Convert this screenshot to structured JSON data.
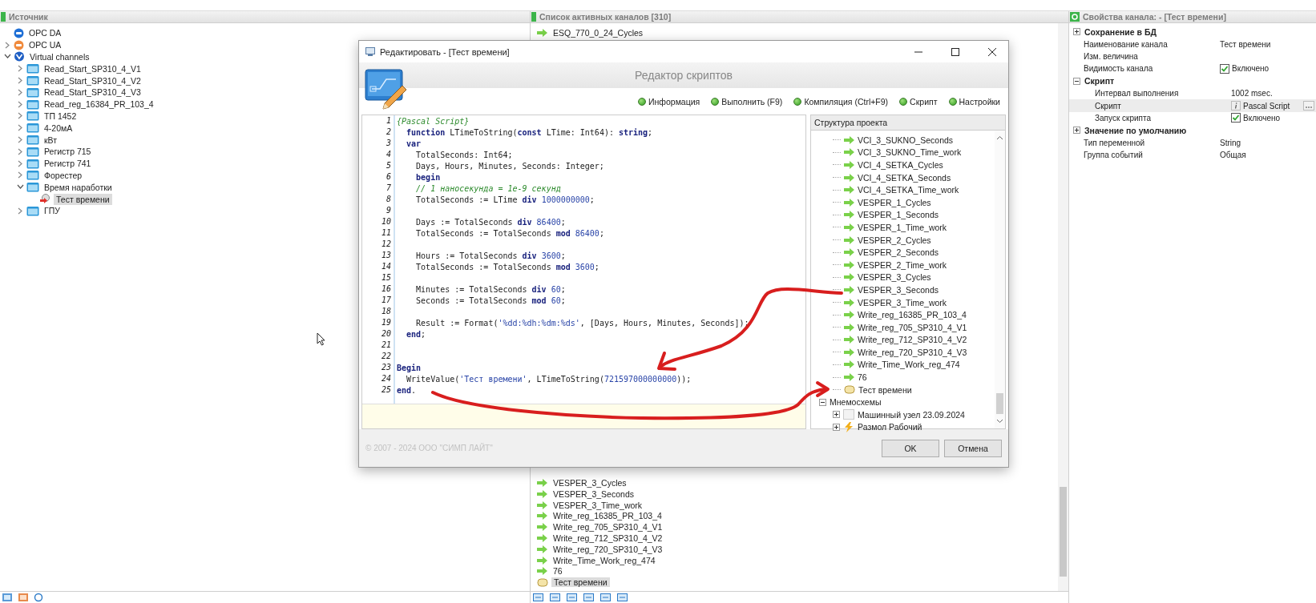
{
  "source_panel": {
    "title": "Источник",
    "tree": [
      {
        "label": "OPC DA",
        "kind": "opc-da",
        "selected": false
      },
      {
        "label": "OPC UA",
        "kind": "opc-ua",
        "expanded": false,
        "selected": false
      },
      {
        "label": "Virtual channels",
        "kind": "virtual",
        "expanded": true,
        "selected": false,
        "children": [
          {
            "label": "Read_Start_SP310_4_V1",
            "kind": "folder",
            "expanded": false,
            "selected": false
          },
          {
            "label": "Read_Start_SP310_4_V2",
            "kind": "folder",
            "expanded": false,
            "selected": false
          },
          {
            "label": "Read_Start_SP310_4_V3",
            "kind": "folder",
            "expanded": false,
            "selected": false
          },
          {
            "label": "Read_reg_16384_PR_103_4",
            "kind": "folder",
            "expanded": false,
            "selected": false
          },
          {
            "label": "ТП 1452",
            "kind": "folder",
            "expanded": false,
            "selected": false
          },
          {
            "label": "4-20мА",
            "kind": "folder",
            "expanded": false,
            "selected": false
          },
          {
            "label": "кВт",
            "kind": "folder",
            "expanded": false,
            "selected": false
          },
          {
            "label": "Регистр 715",
            "kind": "folder",
            "expanded": false,
            "selected": false
          },
          {
            "label": "Регистр 741",
            "kind": "folder",
            "expanded": false,
            "selected": false
          },
          {
            "label": "Форестер",
            "kind": "folder",
            "expanded": false,
            "selected": false
          },
          {
            "label": "Время наработки",
            "kind": "folder",
            "expanded": true,
            "selected": false,
            "children": [
              {
                "label": "Тест времени",
                "kind": "channel",
                "selected": true
              }
            ]
          },
          {
            "label": "ГПУ",
            "kind": "folder",
            "expanded": false,
            "selected": false
          }
        ]
      }
    ]
  },
  "channels_panel": {
    "title": "Список активных каналов [310]",
    "top_items": [
      {
        "label": "ESQ_770_0_24_Cycles",
        "kind": "arrow",
        "selected": false
      }
    ],
    "bottom_items": [
      {
        "label": "VESPER_3_Cycles",
        "kind": "arrow",
        "selected": false
      },
      {
        "label": "VESPER_3_Seconds",
        "kind": "arrow",
        "selected": false
      },
      {
        "label": "VESPER_3_Time_work",
        "kind": "arrow",
        "selected": false
      },
      {
        "label": "Write_reg_16385_PR_103_4",
        "kind": "arrow",
        "selected": false
      },
      {
        "label": "Write_reg_705_SP310_4_V1",
        "kind": "arrow",
        "selected": false
      },
      {
        "label": "Write_reg_712_SP310_4_V2",
        "kind": "arrow",
        "selected": false
      },
      {
        "label": "Write_reg_720_SP310_4_V3",
        "kind": "arrow",
        "selected": false
      },
      {
        "label": "Write_Time_Work_reg_474",
        "kind": "arrow",
        "selected": false
      },
      {
        "label": "76",
        "kind": "arrow",
        "selected": false
      },
      {
        "label": "Тест времени",
        "kind": "script",
        "selected": true
      }
    ]
  },
  "properties_panel": {
    "title": "Свойства канала: - [Тест времени]",
    "rows": [
      {
        "kind": "group",
        "label": "Сохранение в БД",
        "expanded": false
      },
      {
        "kind": "field",
        "label": "Наименование канала",
        "value": "Тест времени"
      },
      {
        "kind": "field",
        "label": "Изм. величина"
      },
      {
        "kind": "check",
        "label": "Видимость канала",
        "checked": true,
        "value": "Включено"
      },
      {
        "kind": "group",
        "label": "Скрипт",
        "expanded": true,
        "children": [
          {
            "kind": "field",
            "label": "Интервал выполнения",
            "value": "1002 msec."
          },
          {
            "kind": "script",
            "label": "Скрипт",
            "value": "Pascal Script",
            "selected": true
          },
          {
            "kind": "check",
            "label": "Запуск скрипта",
            "checked": true,
            "value": "Включено"
          }
        ]
      },
      {
        "kind": "group",
        "label": "Значение по умолчанию",
        "expanded": false
      },
      {
        "kind": "field",
        "label": "Тип переменной",
        "value": "String"
      },
      {
        "kind": "field",
        "label": "Группа событий",
        "value": "Общая"
      }
    ]
  },
  "dialog": {
    "title": "Редактировать - [Тест времени]",
    "banner": "Редактор скриптов",
    "toolbar": [
      "Информация",
      "Выполнить (F9)",
      "Компиляция (Ctrl+F9)",
      "Скрипт",
      "Настройки"
    ],
    "code": [
      {
        "n": "1",
        "tokens": [
          {
            "kind": "comment",
            "text": "{Pascal Script}"
          }
        ]
      },
      {
        "n": "2",
        "tokens": [
          {
            "kind": "keyword",
            "text": "  function"
          },
          {
            "kind": "plain",
            "text": " LTimeToString("
          },
          {
            "kind": "keyword",
            "text": "const"
          },
          {
            "kind": "plain",
            "text": " LTime: Int64): "
          },
          {
            "kind": "keyword",
            "text": "string"
          },
          {
            "kind": "plain",
            "text": ";"
          }
        ]
      },
      {
        "n": "3",
        "tokens": [
          {
            "kind": "keyword",
            "text": "  var"
          }
        ]
      },
      {
        "n": "4",
        "tokens": [
          {
            "kind": "plain",
            "text": "    TotalSeconds: Int64;"
          }
        ]
      },
      {
        "n": "5",
        "tokens": [
          {
            "kind": "plain",
            "text": "    Days, Hours, Minutes, Seconds: Integer;"
          }
        ]
      },
      {
        "n": "6",
        "tokens": [
          {
            "kind": "keyword",
            "text": "    begin"
          }
        ]
      },
      {
        "n": "7",
        "tokens": [
          {
            "kind": "comment",
            "text": "    // 1 наносекунда = 1e-9 секунд"
          }
        ]
      },
      {
        "n": "8",
        "tokens": [
          {
            "kind": "plain",
            "text": "    TotalSeconds := LTime "
          },
          {
            "kind": "keyword",
            "text": "div"
          },
          {
            "kind": "number",
            "text": " 1000000000"
          },
          {
            "kind": "plain",
            "text": ";"
          }
        ]
      },
      {
        "n": "9"
      },
      {
        "n": "10",
        "tokens": [
          {
            "kind": "plain",
            "text": "    Days := TotalSeconds "
          },
          {
            "kind": "keyword",
            "text": "div"
          },
          {
            "kind": "number",
            "text": " 86400"
          },
          {
            "kind": "plain",
            "text": ";"
          }
        ]
      },
      {
        "n": "11",
        "tokens": [
          {
            "kind": "plain",
            "text": "    TotalSeconds := TotalSeconds "
          },
          {
            "kind": "keyword",
            "text": "mod"
          },
          {
            "kind": "number",
            "text": " 86400"
          },
          {
            "kind": "plain",
            "text": ";"
          }
        ]
      },
      {
        "n": "12"
      },
      {
        "n": "13",
        "tokens": [
          {
            "kind": "plain",
            "text": "    Hours := TotalSeconds "
          },
          {
            "kind": "keyword",
            "text": "div"
          },
          {
            "kind": "number",
            "text": " 3600"
          },
          {
            "kind": "plain",
            "text": ";"
          }
        ]
      },
      {
        "n": "14",
        "tokens": [
          {
            "kind": "plain",
            "text": "    TotalSeconds := TotalSeconds "
          },
          {
            "kind": "keyword",
            "text": "mod"
          },
          {
            "kind": "number",
            "text": " 3600"
          },
          {
            "kind": "plain",
            "text": ";"
          }
        ]
      },
      {
        "n": "15"
      },
      {
        "n": "16",
        "tokens": [
          {
            "kind": "plain",
            "text": "    Minutes := TotalSeconds "
          },
          {
            "kind": "keyword",
            "text": "div"
          },
          {
            "kind": "number",
            "text": " 60"
          },
          {
            "kind": "plain",
            "text": ";"
          }
        ]
      },
      {
        "n": "17",
        "tokens": [
          {
            "kind": "plain",
            "text": "    Seconds := TotalSeconds "
          },
          {
            "kind": "keyword",
            "text": "mod"
          },
          {
            "kind": "number",
            "text": " 60"
          },
          {
            "kind": "plain",
            "text": ";"
          }
        ]
      },
      {
        "n": "18"
      },
      {
        "n": "19",
        "tokens": [
          {
            "kind": "plain",
            "text": "    Result := Format("
          },
          {
            "kind": "string",
            "text": "'%dd:%dh:%dm:%ds'"
          },
          {
            "kind": "plain",
            "text": ", [Days, Hours, Minutes, Seconds]);"
          }
        ]
      },
      {
        "n": "20",
        "tokens": [
          {
            "kind": "keyword",
            "text": "  end"
          },
          {
            "kind": "plain",
            "text": ";"
          }
        ]
      },
      {
        "n": "21"
      },
      {
        "n": "22"
      },
      {
        "n": "23",
        "tokens": [
          {
            "kind": "keyword",
            "text": "Begin"
          }
        ]
      },
      {
        "n": "24",
        "tokens": [
          {
            "kind": "plain",
            "text": "  WriteValue("
          },
          {
            "kind": "string",
            "text": "'Тест времени'"
          },
          {
            "kind": "plain",
            "text": ", LTimeToString("
          },
          {
            "kind": "number",
            "text": "721597000000000"
          },
          {
            "kind": "plain",
            "text": "));"
          }
        ]
      },
      {
        "n": "25",
        "tokens": [
          {
            "kind": "keyword",
            "text": "end"
          },
          {
            "kind": "plain",
            "text": "."
          }
        ]
      }
    ],
    "project_tree": {
      "title": "Структура проекта",
      "items": [
        {
          "label": "VCI_3_SUKNO_Seconds",
          "kind": "arrow"
        },
        {
          "label": "VCI_3_SUKNO_Time_work",
          "kind": "arrow"
        },
        {
          "label": "VCI_4_SETKA_Cycles",
          "kind": "arrow"
        },
        {
          "label": "VCI_4_SETKA_Seconds",
          "kind": "arrow"
        },
        {
          "label": "VCI_4_SETKA_Time_work",
          "kind": "arrow"
        },
        {
          "label": "VESPER_1_Cycles",
          "kind": "arrow"
        },
        {
          "label": "VESPER_1_Seconds",
          "kind": "arrow"
        },
        {
          "label": "VESPER_1_Time_work",
          "kind": "arrow"
        },
        {
          "label": "VESPER_2_Cycles",
          "kind": "arrow"
        },
        {
          "label": "VESPER_2_Seconds",
          "kind": "arrow"
        },
        {
          "label": "VESPER_2_Time_work",
          "kind": "arrow"
        },
        {
          "label": "VESPER_3_Cycles",
          "kind": "arrow"
        },
        {
          "label": "VESPER_3_Seconds",
          "kind": "arrow"
        },
        {
          "label": "VESPER_3_Time_work",
          "kind": "arrow"
        },
        {
          "label": "Write_reg_16385_PR_103_4",
          "kind": "arrow"
        },
        {
          "label": "Write_reg_705_SP310_4_V1",
          "kind": "arrow"
        },
        {
          "label": "Write_reg_712_SP310_4_V2",
          "kind": "arrow"
        },
        {
          "label": "Write_reg_720_SP310_4_V3",
          "kind": "arrow"
        },
        {
          "label": "Write_Time_Work_reg_474",
          "kind": "arrow"
        },
        {
          "label": "76",
          "kind": "arrow"
        },
        {
          "label": "Тест времени",
          "kind": "script"
        }
      ],
      "groups": [
        {
          "label": "Мнемосхемы",
          "expanded": true,
          "children": [
            {
              "label": "Машинный узел 23.09.2024",
              "kind": "screen",
              "expanded": false
            },
            {
              "label": "Размол Рабочий",
              "kind": "bolt",
              "expanded": false
            }
          ]
        }
      ]
    },
    "copyright": "© 2007 - 2024 ООО \"СИМП ЛАЙТ\"",
    "buttons": [
      "OK",
      "Отмена"
    ]
  }
}
